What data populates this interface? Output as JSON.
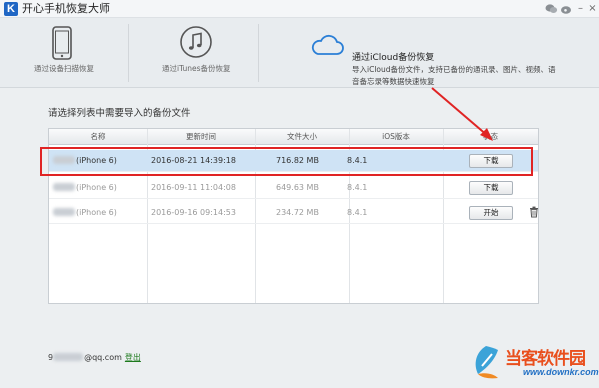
{
  "app": {
    "title": "开心手机恢复大师",
    "logo_letter": "K"
  },
  "window_controls": {
    "wechat": "wechat-icon",
    "weibo": "weibo-icon",
    "minimize": "–",
    "close": "×"
  },
  "tabs": [
    {
      "label": "通过设备扫描恢复",
      "icon": "phone-icon"
    },
    {
      "label": "通过iTunes备份恢复",
      "icon": "music-note-icon"
    },
    {
      "label": "通过iCloud备份恢复",
      "icon": "cloud-icon",
      "active": true,
      "description": "导入iCloud备份文件，支持已备份的通讯录、图片、视频、语音备忘录等数据快速恢复"
    }
  ],
  "section_title": "请选择列表中需要导入的备份文件",
  "table": {
    "headers": [
      "名称",
      "更新时间",
      "文件大小",
      "iOS版本",
      "状态"
    ],
    "rows": [
      {
        "name": "(iPhone 6)",
        "time": "2016-08-21 14:39:18",
        "size": "716.82 MB",
        "ios": "8.4.1",
        "action": "下载",
        "selected": true
      },
      {
        "name": "(iPhone 6)",
        "time": "2016-09-11 11:04:08",
        "size": "649.63 MB",
        "ios": "8.4.1",
        "action": "下载"
      },
      {
        "name": "(iPhone 6)",
        "time": "2016-09-16 09:14:53",
        "size": "234.72 MB",
        "ios": "8.4.1",
        "action": "开始",
        "has_delete": true
      }
    ]
  },
  "account": {
    "email_suffix": "@qq.com",
    "email_prefix": "9",
    "logout": "登出"
  },
  "watermark": {
    "name": "当客软件园",
    "url": "www.downkr.com"
  },
  "colors": {
    "accent": "#1f66c4",
    "highlight": "#e02424",
    "selected_row": "#cfe3f5"
  }
}
